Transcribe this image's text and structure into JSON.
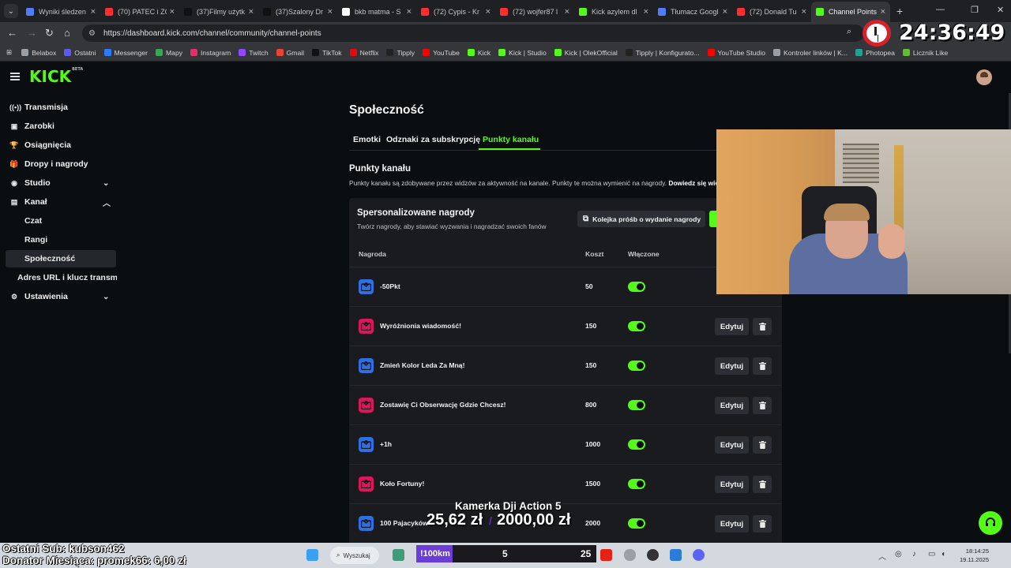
{
  "browser": {
    "tabs": [
      {
        "title": "Wyniki śledzen",
        "color": "#4f7dff"
      },
      {
        "title": "(70) PATEC i ZC",
        "color": "#ff2d2d"
      },
      {
        "title": "(37)Filmy użytk",
        "color": "#111111"
      },
      {
        "title": "(37)Szalony Dr",
        "color": "#111111"
      },
      {
        "title": "bkb matma - S",
        "color": "#ffffff"
      },
      {
        "title": "(72) Cypis - Kr",
        "color": "#ff2d2d"
      },
      {
        "title": "(72) wojfer87 l",
        "color": "#ff2d2d"
      },
      {
        "title": "Kick azylem dl",
        "color": "#53fc18"
      },
      {
        "title": "Tłumacz Googl",
        "color": "#4f7dff"
      },
      {
        "title": "(72) Donald Tu",
        "color": "#ff2d2d"
      },
      {
        "title": "Channel Points",
        "color": "#53fc18"
      }
    ],
    "new_tab": "+",
    "url": "https://dashboard.kick.com/channel/community/channel-points",
    "bookmarks": [
      {
        "label": "Belabox",
        "color": "#9aa0a6"
      },
      {
        "label": "Ostatni",
        "color": "#5b5bf0"
      },
      {
        "label": "Messenger",
        "color": "#2b7bff"
      },
      {
        "label": "Mapy",
        "color": "#34a853"
      },
      {
        "label": "Instagram",
        "color": "#e1306c"
      },
      {
        "label": "Twitch",
        "color": "#9146ff"
      },
      {
        "label": "Gmail",
        "color": "#ea4335"
      },
      {
        "label": "TikTok",
        "color": "#111111"
      },
      {
        "label": "Netflix",
        "color": "#e50914"
      },
      {
        "label": "Tipply",
        "color": "#222222"
      },
      {
        "label": "YouTube",
        "color": "#ff0000"
      },
      {
        "label": "Kick",
        "color": "#53fc18"
      },
      {
        "label": "Kick | Studio",
        "color": "#53fc18"
      },
      {
        "label": "Kick | OlekOfficial",
        "color": "#53fc18"
      },
      {
        "label": "Tipply | Konfigurato...",
        "color": "#222222"
      },
      {
        "label": "YouTube Studio",
        "color": "#ff0000"
      },
      {
        "label": "Kontroler linków | K...",
        "color": "#9aa0a6"
      },
      {
        "label": "Photopea",
        "color": "#18a497"
      },
      {
        "label": "Licznik Like",
        "color": "#5fbf2f"
      }
    ]
  },
  "kick": {
    "logo": "KICK",
    "logo_tag": "BETA",
    "sidebar": {
      "items": [
        {
          "label": "Transmisja",
          "icon": "broadcast-icon",
          "glyph": "((•))"
        },
        {
          "label": "Zarobki",
          "icon": "earnings-icon",
          "glyph": "▣"
        },
        {
          "label": "Osiągnięcia",
          "icon": "trophy-icon",
          "glyph": "🏆"
        },
        {
          "label": "Dropy i nagrody",
          "icon": "gift-icon",
          "glyph": "🎁"
        },
        {
          "label": "Studio",
          "icon": "studio-icon",
          "glyph": "◉"
        },
        {
          "label": "Kanał",
          "icon": "channel-icon",
          "glyph": "▤"
        }
      ],
      "channel_sub": [
        "Czat",
        "Rangi",
        "Społeczność"
      ],
      "stream_key": "Adres URL i klucz transmisji",
      "settings": "Ustawienia"
    },
    "page_title": "Społeczność",
    "tabs": [
      "Emotki",
      "Odznaki za subskrypcję",
      "Punkty kanału"
    ],
    "section": {
      "title": "Punkty kanału",
      "desc": "Punkty kanału są zdobywane przez widzów za aktywność na kanale. Punkty te można wymienić na nagrody.",
      "desc_link": "Dowiedz się więcej"
    },
    "card": {
      "title": "Spersonalizowane nagrody",
      "subtitle": "Twórz nagrody, aby stawiać wyzwania i nagradzać swoich fanów",
      "queue_button": "Kolejka próśb o wydanie nagrody",
      "columns": {
        "name": "Nagroda",
        "cost": "Koszt",
        "enabled": "Włączone"
      },
      "rows": [
        {
          "name": "-50Pkt",
          "cost": "50",
          "color": "#2f6fe0",
          "enabled": true
        },
        {
          "name": "Wyróżnionia wiadomość!",
          "cost": "150",
          "color": "#d8185a",
          "enabled": true
        },
        {
          "name": "Zmień Kolor Leda Za Mną!",
          "cost": "150",
          "color": "#2f6fe0",
          "enabled": true
        },
        {
          "name": "Zostawię Ci Obserwację Gdzie Chcesz!",
          "cost": "800",
          "color": "#d8185a",
          "enabled": true
        },
        {
          "name": "+1h",
          "cost": "1000",
          "color": "#2f6fe0",
          "enabled": true
        },
        {
          "name": "Koło Fortuny!",
          "cost": "1500",
          "color": "#d8185a",
          "enabled": true
        },
        {
          "name": "100 Pajacyków",
          "cost": "2000",
          "color": "#2f6fe0",
          "enabled": true
        }
      ],
      "edit_label": "Edytuj"
    }
  },
  "overlay": {
    "timer": "24:36:49",
    "goal_title": "Kamerka Dji Action 5",
    "goal_current": "25,62 zł",
    "goal_separator": "/",
    "goal_target": "2000,00 zł",
    "last_sub": "Ostatni Sub: kubson462",
    "donator": "Donator Miesiąca: promek66: 6,00 zł",
    "ticker_label": "!100km",
    "ticker_a": "5",
    "ticker_b": "25"
  },
  "taskbar": {
    "search": "Wyszukaj",
    "time": "18:14:25",
    "date": "19.11.2025"
  },
  "colors": {
    "accent": "#53fc18",
    "bg": "#0b0e11",
    "card": "#191b1f"
  }
}
